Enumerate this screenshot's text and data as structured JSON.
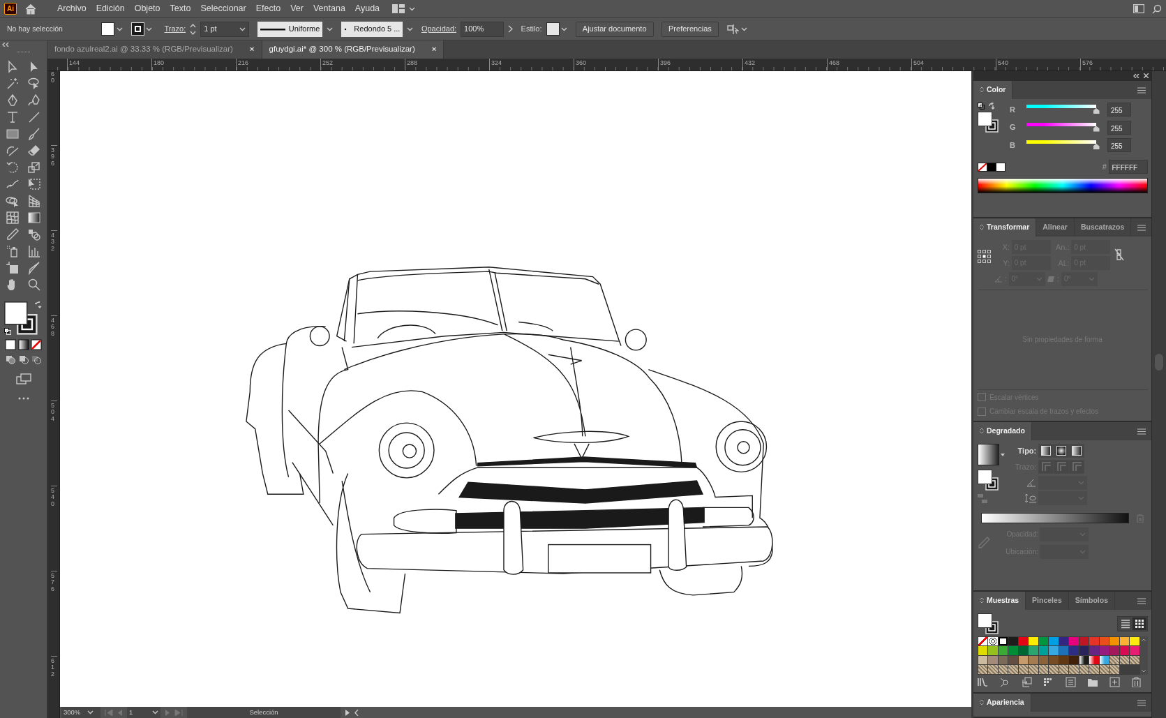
{
  "app": {
    "logo": "Ai",
    "menu": [
      "Archivo",
      "Edición",
      "Objeto",
      "Texto",
      "Seleccionar",
      "Efecto",
      "Ver",
      "Ventana",
      "Ayuda"
    ]
  },
  "control_bar": {
    "selection_label": "No hay selección",
    "stroke_label": "Trazo:",
    "stroke_weight": "1 pt",
    "profile": "Uniforme",
    "brush": "Redondo 5 ...",
    "opacity_label": "Opacidad:",
    "opacity": "100%",
    "style_label": "Estilo:",
    "buttons": [
      "Ajustar documento",
      "Preferencias"
    ]
  },
  "tabs": [
    {
      "label": "fondo azulreal2.ai @ 33.33 % (RGB/Previsualizar)",
      "close": "×",
      "selected": false
    },
    {
      "label": "gfuydgi.ai* @ 300 % (RGB/Previsualizar)",
      "close": "×",
      "selected": true
    }
  ],
  "rulers": {
    "horizontal": [
      "144",
      "180",
      "216",
      "252",
      "288",
      "324",
      "360",
      "396",
      "432",
      "468",
      "504",
      "540",
      "576"
    ],
    "vertical": [
      "60",
      "396",
      "432",
      "468",
      "504",
      "540",
      "576",
      "612"
    ]
  },
  "color_panel": {
    "title": "Color",
    "channels": [
      {
        "name": "R",
        "value": "255",
        "level": 1,
        "color": "#00ffff"
      },
      {
        "name": "G",
        "value": "255",
        "level": 1,
        "color": "#ff00ff"
      },
      {
        "name": "B",
        "value": "255",
        "level": 1,
        "color": "#ffff00"
      }
    ],
    "hash": "#",
    "hex": "FFFFFF"
  },
  "transform_panel": {
    "tabs": [
      {
        "label": "Transformar",
        "selected": true
      },
      {
        "label": "Alinear",
        "selected": false
      },
      {
        "label": "Buscatrazos",
        "selected": false
      }
    ],
    "fields": [
      {
        "label": "X:",
        "value": "0 pt"
      },
      {
        "label": "An.:",
        "value": "0 pt"
      },
      {
        "label": "Y:",
        "value": "0 pt"
      },
      {
        "label": "Al.:",
        "value": "0 pt"
      }
    ],
    "angles": [
      {
        "label": ":",
        "value": "0°"
      },
      {
        "label": ":",
        "value": "0°"
      }
    ],
    "message": "Sin propiedades de forma",
    "options": [
      {
        "label": "Escalar vértices",
        "checked": false
      },
      {
        "label": "Cambiar escala de trazos y efectos",
        "checked": false
      }
    ]
  },
  "gradient_panel": {
    "title": "Degradado",
    "type_label": "Tipo:",
    "stroke_label": "Trazo:",
    "opacity_label": "Opacidad:",
    "location_label": "Ubicación:"
  },
  "swatches_panel": {
    "tabs": [
      {
        "label": "Muestras",
        "selected": true
      },
      {
        "label": "Pinceles",
        "selected": false
      },
      {
        "label": "Símbolos",
        "selected": false
      }
    ],
    "swatches": [
      {
        "kind": "none"
      },
      {
        "kind": "registration"
      },
      {
        "kind": "solid",
        "color": "#ffffff"
      },
      {
        "kind": "solid",
        "color": "#1d1d1b"
      },
      {
        "kind": "solid",
        "color": "#e30613"
      },
      {
        "kind": "solid",
        "color": "#ffed00"
      },
      {
        "kind": "solid",
        "color": "#009640"
      },
      {
        "kind": "solid",
        "color": "#009fe3"
      },
      {
        "kind": "solid",
        "color": "#312783"
      },
      {
        "kind": "solid",
        "color": "#e6007e"
      },
      {
        "kind": "solid",
        "color": "#be1622"
      },
      {
        "kind": "solid",
        "color": "#e6332a"
      },
      {
        "kind": "solid",
        "color": "#e94e1b"
      },
      {
        "kind": "solid",
        "color": "#f39200"
      },
      {
        "kind": "solid",
        "color": "#f9b233"
      },
      {
        "kind": "solid",
        "color": "#fcea10"
      },
      {
        "kind": "solid",
        "color": "#dedc00"
      },
      {
        "kind": "solid",
        "color": "#95c11f"
      },
      {
        "kind": "solid",
        "color": "#3aaa35"
      },
      {
        "kind": "solid",
        "color": "#008d36"
      },
      {
        "kind": "solid",
        "color": "#006633"
      },
      {
        "kind": "solid",
        "color": "#2ca470"
      },
      {
        "kind": "solid",
        "color": "#00a19a"
      },
      {
        "kind": "solid",
        "color": "#36a9e1"
      },
      {
        "kind": "solid",
        "color": "#1d71b8"
      },
      {
        "kind": "solid",
        "color": "#2d2e83"
      },
      {
        "kind": "solid",
        "color": "#29235c"
      },
      {
        "kind": "solid",
        "color": "#662483"
      },
      {
        "kind": "solid",
        "color": "#951b81"
      },
      {
        "kind": "solid",
        "color": "#a3195b"
      },
      {
        "kind": "solid",
        "color": "#d60b52"
      },
      {
        "kind": "solid",
        "color": "#e71d73"
      },
      {
        "kind": "solid",
        "color": "#cbbba0"
      },
      {
        "kind": "solid",
        "color": "#a48a7b"
      },
      {
        "kind": "solid",
        "color": "#7b6a58"
      },
      {
        "kind": "solid",
        "color": "#634e42"
      },
      {
        "kind": "solid",
        "color": "#c69c6d"
      },
      {
        "kind": "solid",
        "color": "#a57b52"
      },
      {
        "kind": "solid",
        "color": "#8c6239"
      },
      {
        "kind": "solid",
        "color": "#754c24"
      },
      {
        "kind": "solid",
        "color": "#603813"
      },
      {
        "kind": "solid",
        "color": "#42210b"
      },
      {
        "kind": "gradient",
        "color": "#1d1d1b"
      },
      {
        "kind": "gradient",
        "color": "#e30613"
      },
      {
        "kind": "gradient",
        "color": "#36a9e1"
      },
      {
        "kind": "pattern"
      },
      {
        "kind": "pattern"
      },
      {
        "kind": "pattern"
      },
      {
        "kind": "pattern"
      },
      {
        "kind": "pattern"
      },
      {
        "kind": "pattern"
      },
      {
        "kind": "pattern"
      },
      {
        "kind": "pattern"
      },
      {
        "kind": "pattern"
      },
      {
        "kind": "pattern"
      },
      {
        "kind": "pattern"
      },
      {
        "kind": "pattern"
      },
      {
        "kind": "pattern"
      },
      {
        "kind": "pattern"
      },
      {
        "kind": "pattern"
      },
      {
        "kind": "pattern"
      },
      {
        "kind": "pattern"
      }
    ]
  },
  "appearance_panel": {
    "title": "Apariencia"
  },
  "status_bar": {
    "zoom": "300%",
    "artboard": "1",
    "tool": "Selección"
  }
}
